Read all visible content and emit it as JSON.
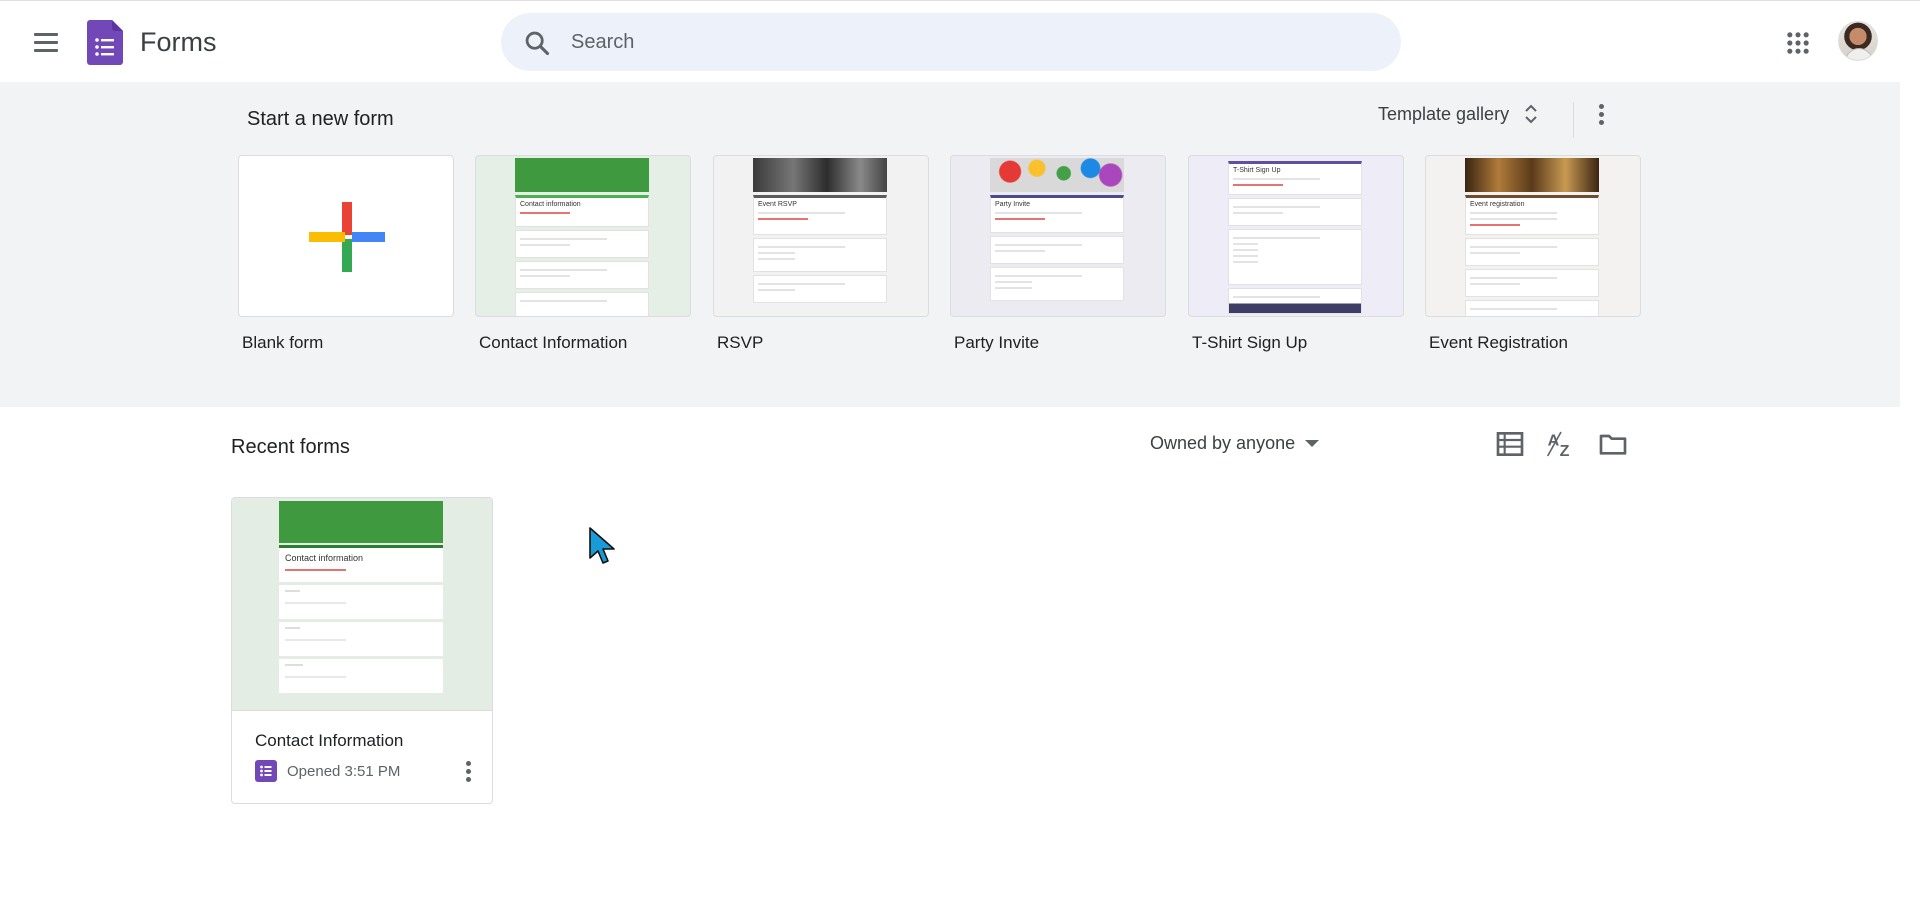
{
  "header": {
    "app_title": "Forms",
    "search_placeholder": "Search"
  },
  "templates": {
    "section_title": "Start a new form",
    "gallery_label": "Template gallery",
    "items": [
      {
        "label": "Blank form"
      },
      {
        "label": "Contact Information",
        "preview_title": "Contact information"
      },
      {
        "label": "RSVP",
        "preview_title": "Event RSVP"
      },
      {
        "label": "Party Invite",
        "preview_title": "Party Invite"
      },
      {
        "label": "T-Shirt Sign Up",
        "preview_title": "T-Shirt Sign Up"
      },
      {
        "label": "Event Registration",
        "preview_title": "Event registration"
      }
    ]
  },
  "recent": {
    "section_title": "Recent forms",
    "owner_filter": "Owned by anyone",
    "docs": [
      {
        "title": "Contact Information",
        "meta": "Opened 3:51 PM",
        "preview_title": "Contact information"
      }
    ]
  },
  "colors": {
    "forms_purple": "#7248b9",
    "search_bg": "#edf1fa",
    "band_bg": "#f1f3f4"
  }
}
